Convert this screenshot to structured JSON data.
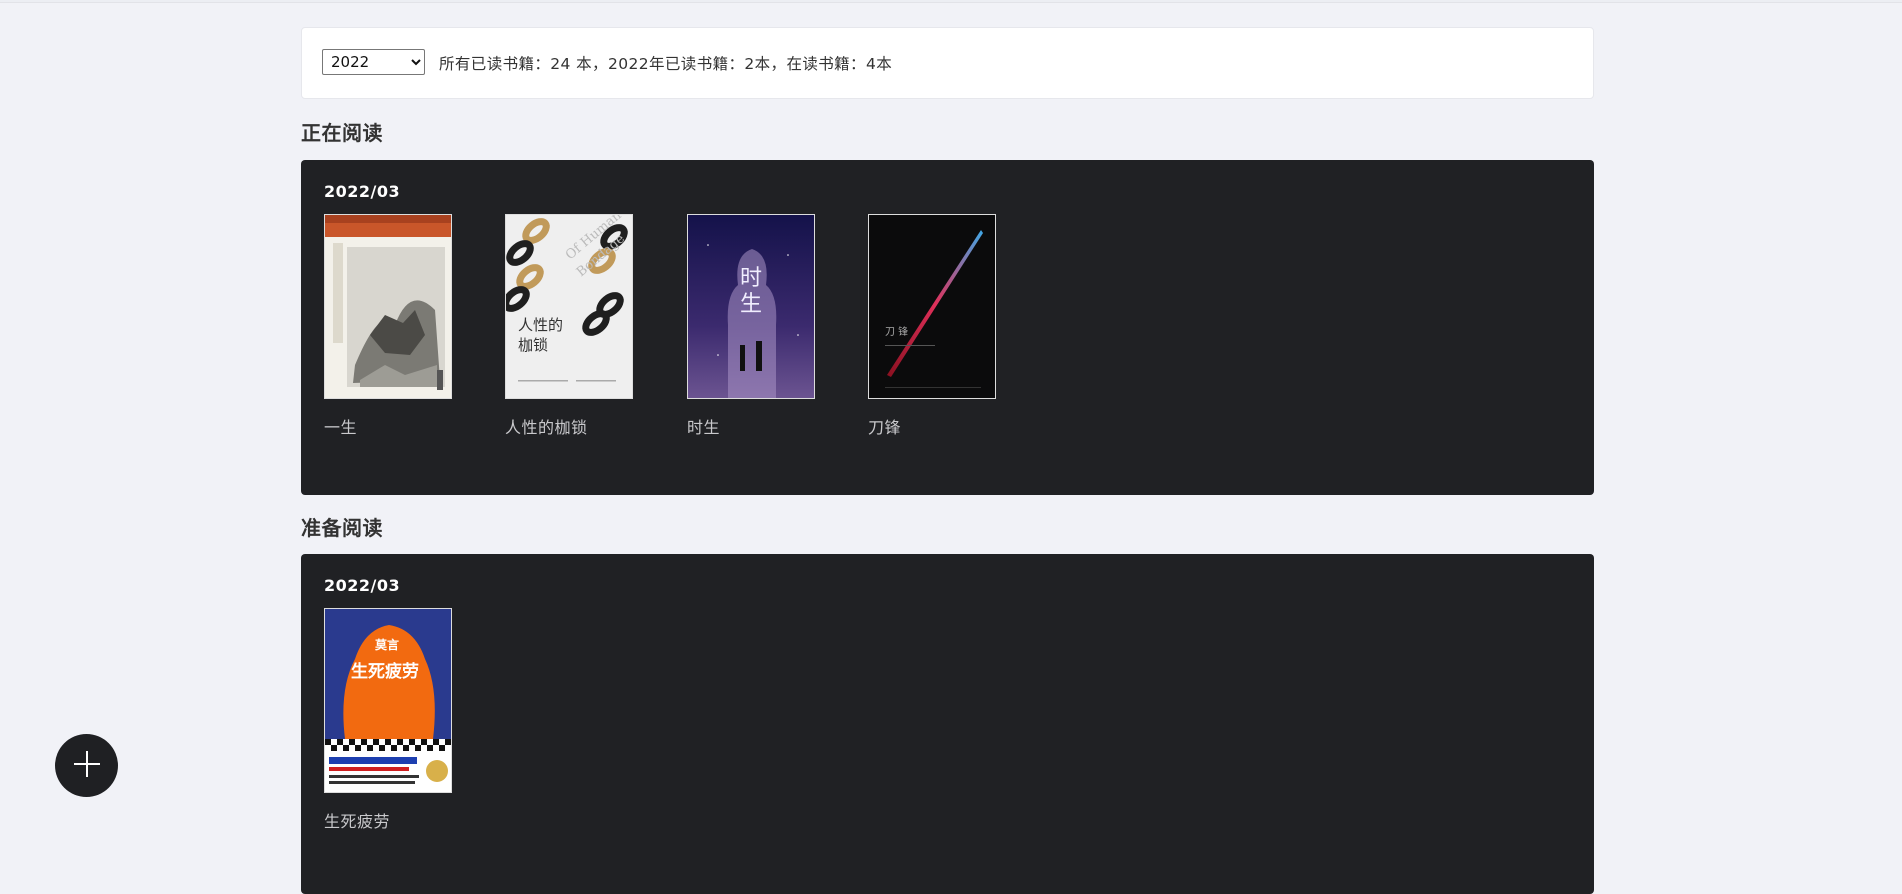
{
  "filter": {
    "year_selected": "2022",
    "year_options": [
      "2022"
    ],
    "stats_text": "所有已读书籍：24 本，2022年已读书籍：2本，在读书籍：4本"
  },
  "reading": {
    "title": "正在阅读",
    "groups": [
      {
        "date": "2022/03",
        "books": [
          {
            "title": "一生"
          },
          {
            "title": "人性的枷锁"
          },
          {
            "title": "时生"
          },
          {
            "title": "刀锋"
          }
        ]
      }
    ]
  },
  "to_read": {
    "title": "准备阅读",
    "groups": [
      {
        "date": "2022/03",
        "books": [
          {
            "title": "生死疲劳"
          }
        ]
      }
    ]
  },
  "icons": {
    "add": "plus-icon"
  },
  "colors": {
    "page_bg": "#f1f2f7",
    "shelf_bg": "#202124",
    "fab_bg": "#1f2023"
  }
}
